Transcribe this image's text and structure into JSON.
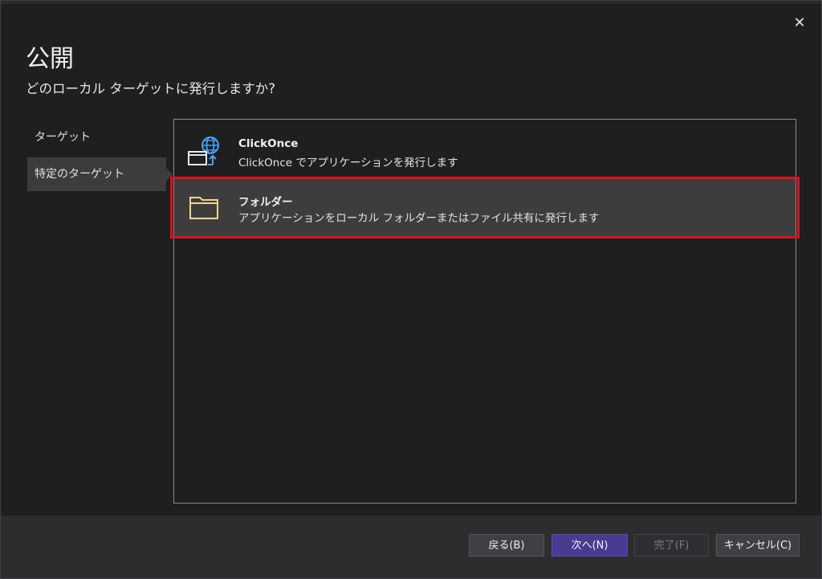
{
  "dialog": {
    "title": "公開",
    "subtitle": "どのローカル ターゲットに発行しますか?",
    "close_label": "✕"
  },
  "nav": {
    "items": [
      {
        "label": "ターゲット",
        "selected": false
      },
      {
        "label": "特定のターゲット",
        "selected": true
      }
    ]
  },
  "options": [
    {
      "name": "ClickOnce",
      "description": "ClickOnce でアプリケーションを発行します",
      "icon": "globe-window-upload-icon",
      "selected": false
    },
    {
      "name": "フォルダー",
      "description": "アプリケーションをローカル フォルダーまたはファイル共有に発行します",
      "icon": "folder-icon",
      "selected": true
    }
  ],
  "buttons": {
    "back": "戻る(B)",
    "next": "次へ(N)",
    "finish": "完了(F)",
    "cancel": "キャンセル(C)"
  },
  "colors": {
    "accent": "#4a3b91",
    "highlight": "#e0101b",
    "folder": "#f5d48a",
    "globe": "#4aa3ff"
  }
}
